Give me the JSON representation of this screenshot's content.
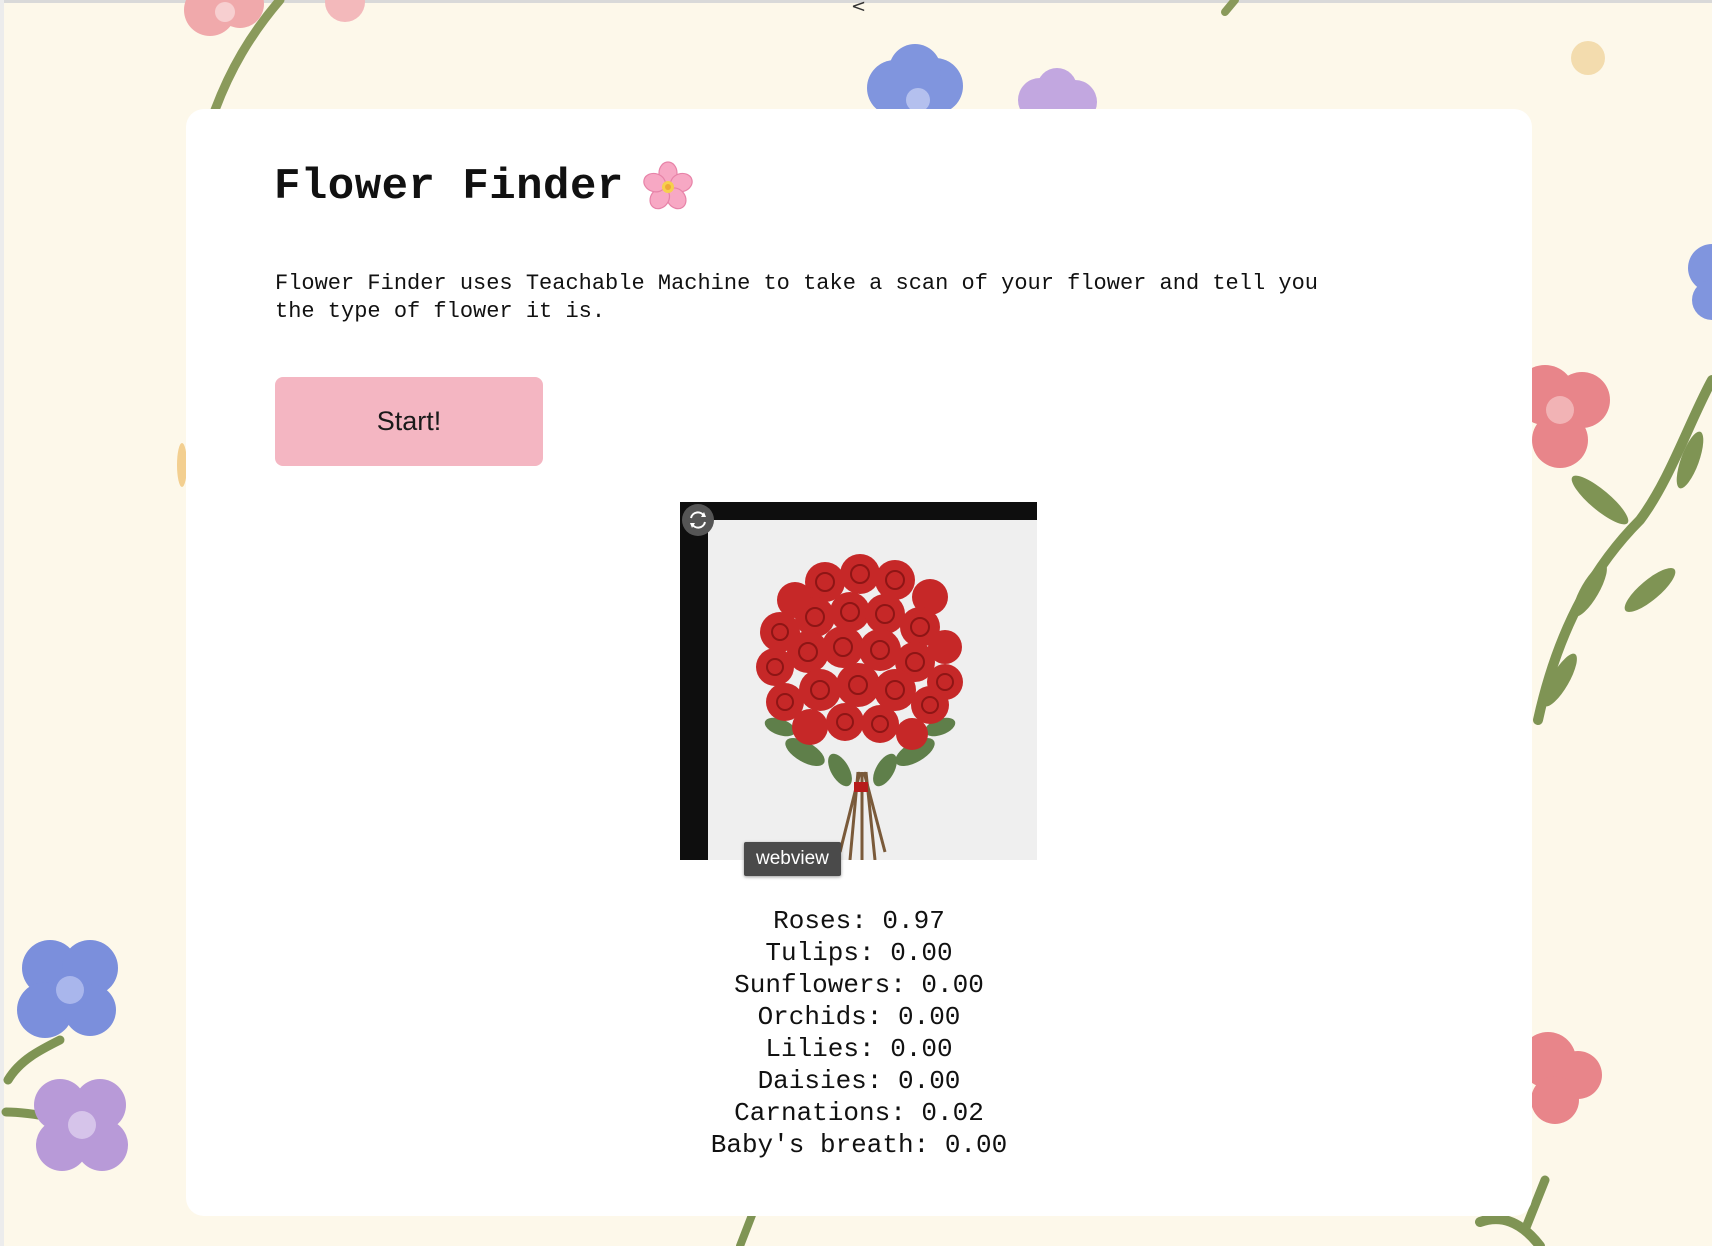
{
  "nav": {
    "back_glyph": "<"
  },
  "app": {
    "title": "Flower Finder",
    "title_icon": "cherry-blossom-icon",
    "description": "Flower Finder uses Teachable Machine to take a scan of your flower and tell you the type of flower it is.",
    "start_label": "Start!"
  },
  "webcam": {
    "tag_label": "webview",
    "switch_icon": "camera-switch-icon"
  },
  "predictions": [
    {
      "label": "Roses",
      "value": "0.97"
    },
    {
      "label": "Tulips",
      "value": "0.00"
    },
    {
      "label": "Sunflowers",
      "value": "0.00"
    },
    {
      "label": "Orchids",
      "value": "0.00"
    },
    {
      "label": "Lilies",
      "value": "0.00"
    },
    {
      "label": "Daisies",
      "value": "0.00"
    },
    {
      "label": "Carnations",
      "value": "0.02"
    },
    {
      "label": "Baby's breath",
      "value": "0.00"
    }
  ],
  "colors": {
    "background": "#fdf8ea",
    "card": "#ffffff",
    "start_button": "#f4b6c2",
    "rose_red": "#c62828",
    "stem_green": "#7f9454",
    "petal_blue": "#7b8fdc",
    "petal_pink": "#e8858a",
    "petal_purple": "#b89ad8"
  }
}
